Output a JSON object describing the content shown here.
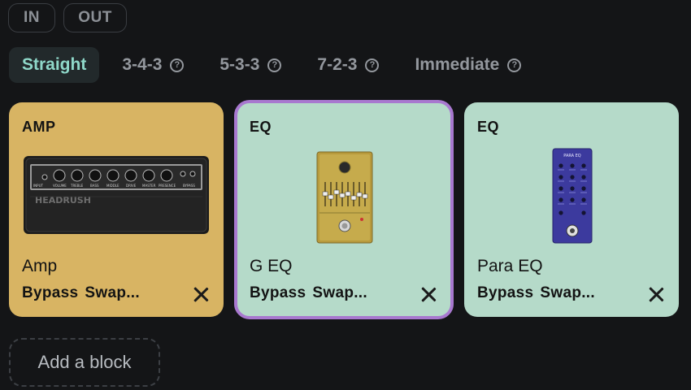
{
  "io": {
    "in_label": "IN",
    "out_label": "OUT"
  },
  "tabs": [
    {
      "label": "Straight",
      "active": true,
      "help": false
    },
    {
      "label": "3-4-3",
      "active": false,
      "help": true
    },
    {
      "label": "5-3-3",
      "active": false,
      "help": true
    },
    {
      "label": "7-2-3",
      "active": false,
      "help": true
    },
    {
      "label": "Immediate",
      "active": false,
      "help": true
    }
  ],
  "help_glyph": "?",
  "blocks": [
    {
      "category": "AMP",
      "name": "Amp",
      "bypass": "Bypass",
      "swap": "Swap...",
      "color": "#d8b463",
      "selected": false,
      "image": "amp-head-icon",
      "brand_text": "HEADRUSH"
    },
    {
      "category": "EQ",
      "name": "G EQ",
      "bypass": "Bypass",
      "swap": "Swap...",
      "color": "#b5dac9",
      "selected": true,
      "image": "graphic-eq-pedal-icon"
    },
    {
      "category": "EQ",
      "name": "Para EQ",
      "bypass": "Bypass",
      "swap": "Swap...",
      "color": "#b5dac9",
      "selected": false,
      "image": "parametric-eq-pedal-icon",
      "brand_text": "PARA EQ"
    }
  ],
  "add_block_label": "Add a block",
  "colors": {
    "background": "#141517",
    "accent": "#8fd8c9",
    "selected_outline": "#a878cf"
  }
}
